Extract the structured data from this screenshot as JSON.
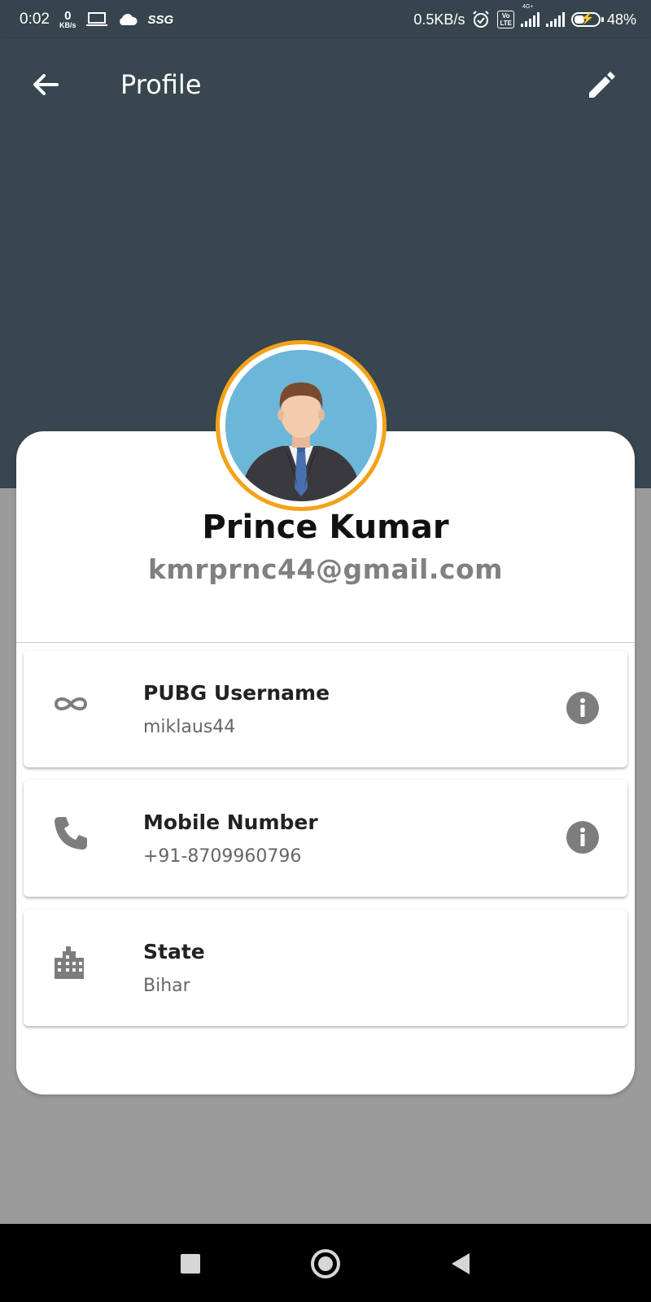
{
  "status_bar": {
    "time": "0:02",
    "net_speed_value": "0",
    "net_speed_unit": "KB/s",
    "carrier_tag": "SSG",
    "net_rate": "0.5KB/s",
    "volte_top": "Vo",
    "volte_bottom": "LTE",
    "network_type": "4G+",
    "battery": "48%"
  },
  "app_bar": {
    "title": "Profile"
  },
  "profile": {
    "name": "Prince Kumar",
    "email": "kmrprnc44@gmail.com"
  },
  "details": [
    {
      "title": "PUBG Username",
      "value": "miklaus44",
      "icon": "infinity-icon",
      "has_info": true
    },
    {
      "title": "Mobile Number",
      "value": "+91-8709960796",
      "icon": "phone-icon",
      "has_info": true
    },
    {
      "title": "State",
      "value": "Bihar",
      "icon": "building-icon",
      "has_info": false
    }
  ],
  "colors": {
    "primary": "#37464f",
    "avatar_ring": "#f4a21a",
    "page_background": "#9b9b9b",
    "icon_gray": "#7d7d7d"
  }
}
